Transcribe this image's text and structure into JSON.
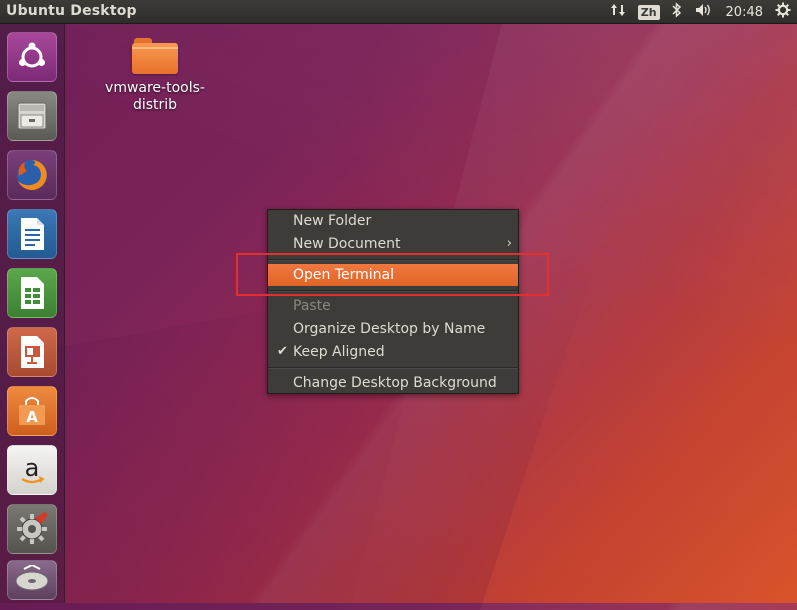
{
  "panel": {
    "title": "Ubuntu Desktop",
    "input_method": "Zh",
    "clock": "20:48",
    "icons": [
      "network-arrows-icon",
      "keyboard-layout-icon",
      "bluetooth-icon",
      "volume-icon",
      "power-gear-icon"
    ]
  },
  "launcher": {
    "items": [
      {
        "name": "ubuntu-dash-icon"
      },
      {
        "name": "files-icon"
      },
      {
        "name": "firefox-icon"
      },
      {
        "name": "libreoffice-writer-icon"
      },
      {
        "name": "libreoffice-calc-icon"
      },
      {
        "name": "libreoffice-impress-icon"
      },
      {
        "name": "software-center-icon"
      },
      {
        "name": "amazon-icon"
      },
      {
        "name": "system-settings-icon"
      },
      {
        "name": "dvd-icon"
      }
    ],
    "glyphs": {
      "amazon": "a",
      "store": "A"
    }
  },
  "desktop": {
    "icon_label": "vmware-tools-distrib"
  },
  "menu": {
    "items": [
      {
        "label": "New Folder"
      },
      {
        "label": "New Document",
        "submenu_glyph": "›"
      },
      {
        "label": "Open Terminal",
        "state": "highlighted"
      },
      {
        "label": "Paste",
        "state": "disabled"
      },
      {
        "label": "Organize Desktop by Name"
      },
      {
        "label": "Keep Aligned",
        "checked": true,
        "check_glyph": "✔"
      },
      {
        "label": "Change Desktop Background"
      }
    ]
  },
  "colors": {
    "accent": "#e9652a",
    "annotation": "#e2302f"
  }
}
